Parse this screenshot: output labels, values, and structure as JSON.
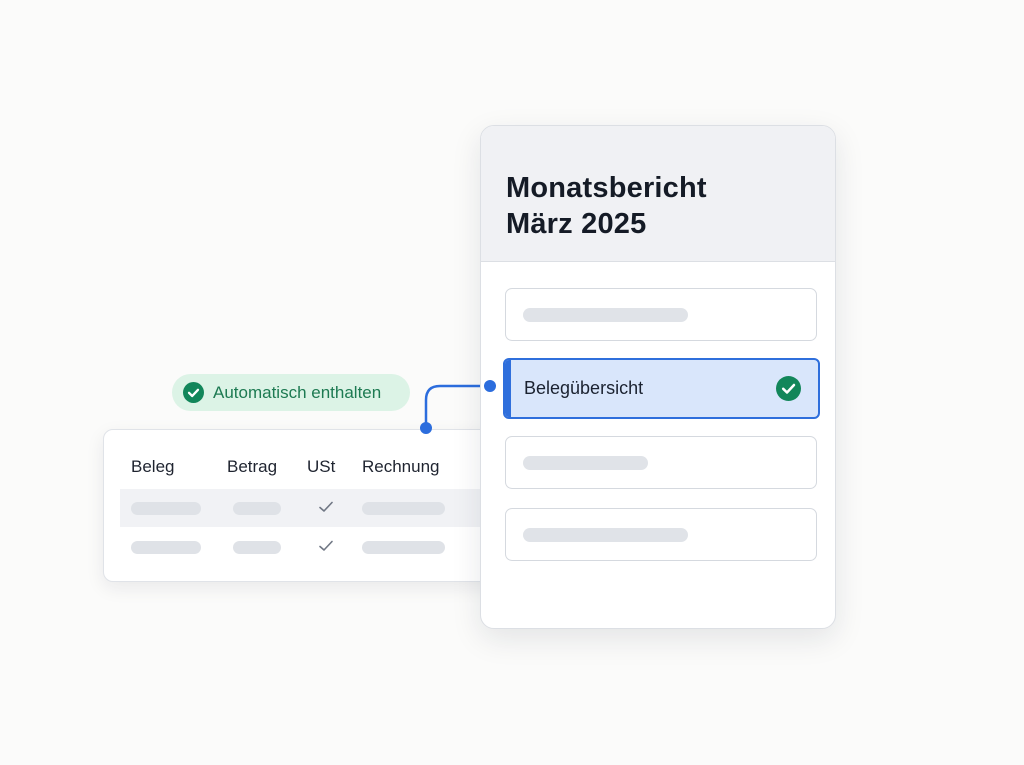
{
  "badge": {
    "text": "Automatisch enthalten",
    "icon": "check-circle-icon",
    "color": "#12865a"
  },
  "table": {
    "columns": [
      "Beleg",
      "Betrag",
      "USt",
      "Rechnung"
    ],
    "rows": [
      {
        "ust_checked": true
      },
      {
        "ust_checked": true
      }
    ]
  },
  "report": {
    "title_line1": "Monatsbericht",
    "title_line2": "März 2025",
    "selected_item_label": "Belegübersicht",
    "selected_item_icon": "check-circle-icon",
    "accent_color": "#2f6fdc",
    "success_color": "#12865a"
  }
}
